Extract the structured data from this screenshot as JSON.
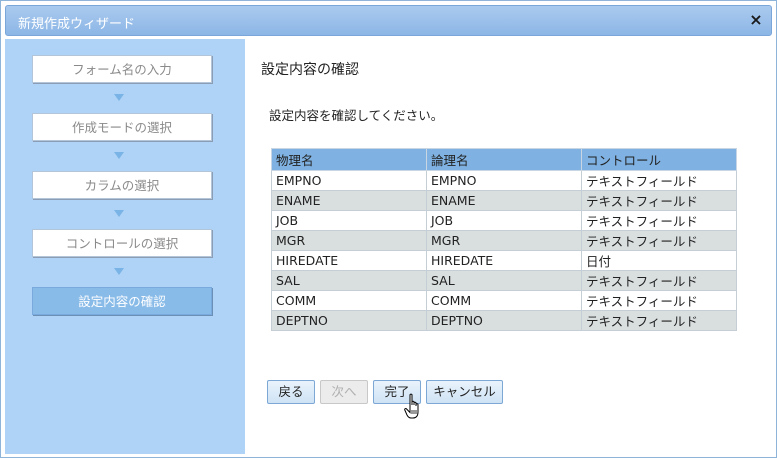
{
  "window": {
    "title": "新規作成ウィザード",
    "close_icon": "×"
  },
  "sidebar": {
    "steps": [
      {
        "label": "フォーム名の入力",
        "active": false
      },
      {
        "label": "作成モードの選択",
        "active": false
      },
      {
        "label": "カラムの選択",
        "active": false
      },
      {
        "label": "コントロールの選択",
        "active": false
      },
      {
        "label": "設定内容の確認",
        "active": true
      }
    ]
  },
  "main": {
    "heading": "設定内容の確認",
    "instruction": "設定内容を確認してください。",
    "table": {
      "columns": [
        "物理名",
        "論理名",
        "コントロール"
      ],
      "rows": [
        [
          "EMPNO",
          "EMPNO",
          "テキストフィールド"
        ],
        [
          "ENAME",
          "ENAME",
          "テキストフィールド"
        ],
        [
          "JOB",
          "JOB",
          "テキストフィールド"
        ],
        [
          "MGR",
          "MGR",
          "テキストフィールド"
        ],
        [
          "HIREDATE",
          "HIREDATE",
          "日付"
        ],
        [
          "SAL",
          "SAL",
          "テキストフィールド"
        ],
        [
          "COMM",
          "COMM",
          "テキストフィールド"
        ],
        [
          "DEPTNO",
          "DEPTNO",
          "テキストフィールド"
        ]
      ]
    }
  },
  "buttons": {
    "back_label": "戻る",
    "next_label": "次へ",
    "finish_label": "完了",
    "cancel_label": "キャンセル"
  },
  "colors": {
    "titlebar": "#8cb6e6",
    "sidebar": "#aed3f6",
    "table_header": "#7fb2e2",
    "active_step": "#89bbe8"
  }
}
